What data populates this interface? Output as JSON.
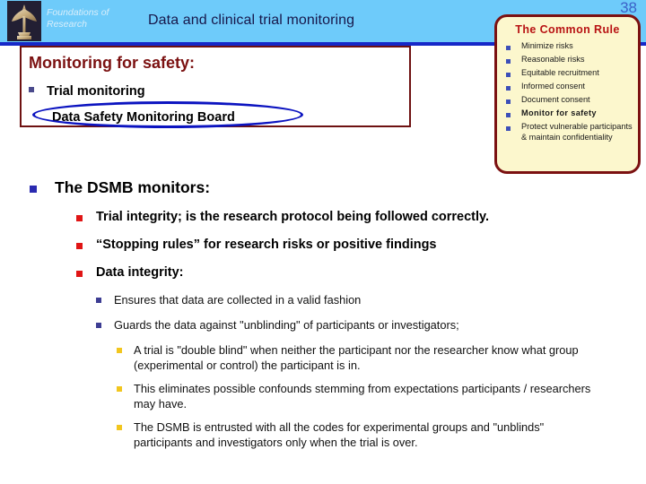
{
  "header": {
    "brand_line1": "Foundations of",
    "brand_line2": "Research",
    "title": "Data and clinical trial monitoring",
    "page_number": "38",
    "band_color": "#6ECBFA",
    "rule_color": "#1628C8",
    "page_number_color": "#3b62c9"
  },
  "logo": {
    "name": "foundations-of-research-statue"
  },
  "red_box": {
    "heading": "Monitoring for safety:",
    "heading_color": "#7B1111",
    "border_color": "#6E1111",
    "items": [
      {
        "label": "Trial monitoring"
      },
      {
        "label": "Data Safety Monitoring Board"
      }
    ],
    "highlight_ellipse_color": "#0b13c0"
  },
  "common_rule": {
    "title": "The Common Rule",
    "title_color": "#B81313",
    "background": "#FCF7CD",
    "border_color": "#7B1111",
    "items": [
      {
        "label": "Minimize risks",
        "emphasis": false
      },
      {
        "label": "Reasonable risks",
        "emphasis": false
      },
      {
        "label": "Equitable recruitment",
        "emphasis": false
      },
      {
        "label": "Informed consent",
        "emphasis": false
      },
      {
        "label": "Document consent",
        "emphasis": false
      },
      {
        "label": "Monitor for safety",
        "emphasis": true
      },
      {
        "label": "Protect vulnerable participants & maintain confidentiality",
        "emphasis": false
      }
    ]
  },
  "body": {
    "heading": "The DSMB monitors:",
    "level2": [
      {
        "label": "Trial integrity; is the research protocol being followed correctly."
      },
      {
        "label": "“Stopping rules” for research risks or positive findings"
      },
      {
        "label": "Data integrity:"
      }
    ],
    "level3": [
      {
        "label": "Ensures that data are collected in a valid fashion"
      },
      {
        "label": "Guards the data against \"unblinding\" of participants or investigators;"
      }
    ],
    "level4": [
      {
        "label": "A trial is \"double blind\" when neither the participant nor the researcher know what group (experimental or control) the participant is in."
      },
      {
        "label": "This eliminates possible confounds stemming from expectations participants / researchers may have."
      },
      {
        "label": " The DSMB is entrusted with all the codes for experimental groups and \"unblinds\" participants and investigators only when the trial is over."
      }
    ]
  }
}
